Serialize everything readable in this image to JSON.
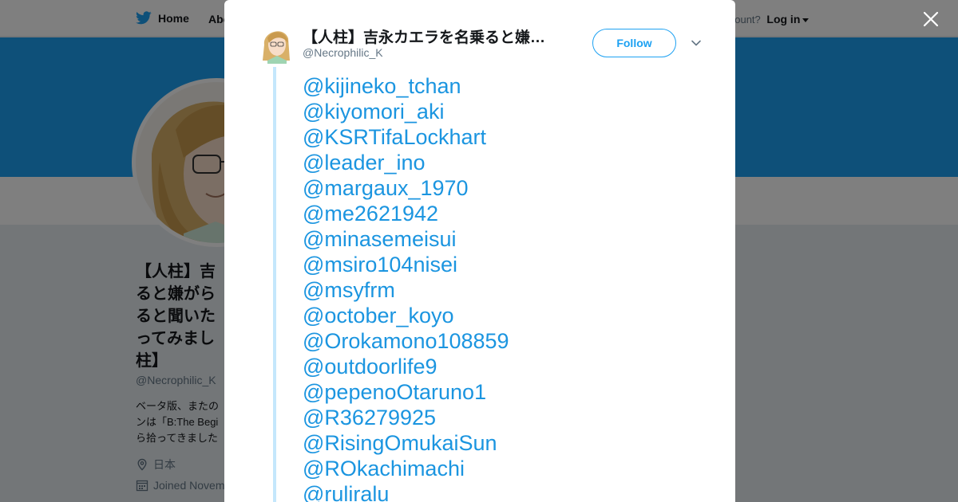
{
  "nav": {
    "home_label": "Home",
    "about_label": "Abo",
    "account_prompt": "account?",
    "login_label": "Log in"
  },
  "profile": {
    "name": "【人柱】吉\nると嫌がら\nると聞いた\nってみまし\n柱】",
    "handle": "@Necrophilic_K",
    "bio": "ベータ版、またの\nンは「B:The Begi\nら拾ってきました",
    "location": "日本",
    "joined": "Joined Novem"
  },
  "tweet": {
    "author_name": "【人柱】吉永カエラを名乗ると嫌がらせを受けると聞いたので",
    "author_handle": "@Necrophilic_K",
    "follow_label": "Follow",
    "mentions": [
      "@kijineko_tchan",
      "@kiyomori_aki",
      "@KSRTifaLockhart",
      "@leader_ino",
      "@margaux_1970",
      "@me2621942",
      "@minasemeisui",
      "@msiro104nisei",
      "@msyfrm",
      "@october_koyo",
      "@Orokamono108859",
      "@outdoorlife9",
      "@pepenoOtaruno1",
      "@R36279925",
      "@RisingOmukaiSun",
      "@ROkachimachi",
      "@ruliralu"
    ]
  },
  "colors": {
    "accent": "#1da1f2",
    "link": "#1b95e0",
    "thread_line": "#c4e7fc"
  },
  "icons": [
    "twitter-bird-icon",
    "close-icon",
    "chevron-down-icon",
    "location-pin-icon",
    "calendar-icon"
  ]
}
